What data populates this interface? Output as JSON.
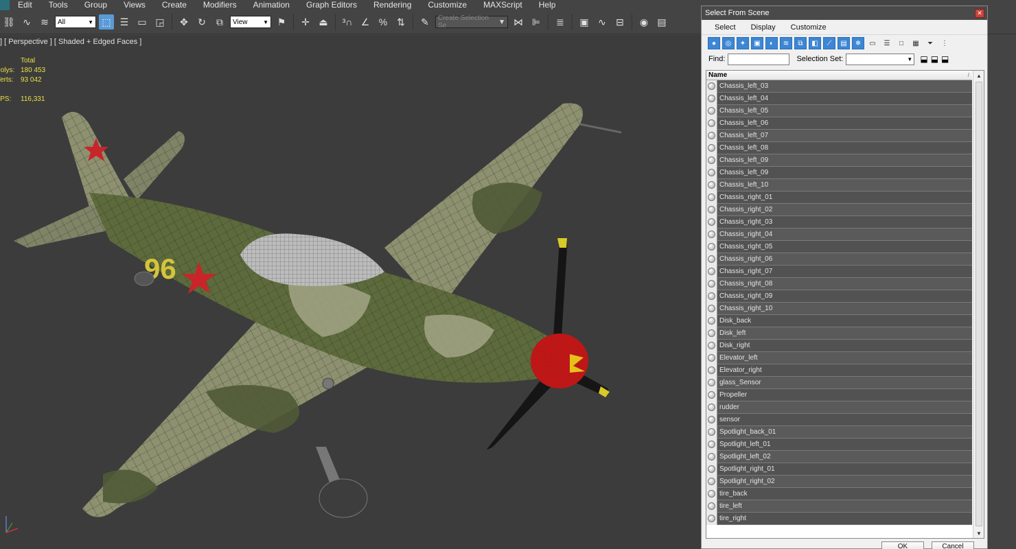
{
  "menu": [
    "Edit",
    "Tools",
    "Group",
    "Views",
    "Create",
    "Modifiers",
    "Animation",
    "Graph Editors",
    "Rendering",
    "Customize",
    "MAXScript",
    "Help"
  ],
  "toolbar": {
    "filter_select": "All",
    "reference_select": "View",
    "selection_set_placeholder": "Create Selection Se"
  },
  "viewport": {
    "label": "] [ Perspective ] [ Shaded + Edged Faces ]",
    "stats": {
      "header": "Total",
      "polys_label": "Polys:",
      "polys": "180 453",
      "verts_label": "Verts:",
      "verts": "93 042",
      "fps_label": "FPS:",
      "fps": "116,331"
    },
    "model_numeral": "96"
  },
  "dialog": {
    "title": "Select From Scene",
    "menu": [
      "Select",
      "Display",
      "Customize"
    ],
    "find_label": "Find:",
    "selection_set_label": "Selection Set:",
    "column_header": "Name",
    "items": [
      "Chassis_left_03",
      "Chassis_left_04",
      "Chassis_left_05",
      "Chassis_left_06",
      "Chassis_left_07",
      "Chassis_left_08",
      "Chassis_left_09",
      "Chassis_left_09",
      "Chassis_left_10",
      "Chassis_right_01",
      "Chassis_right_02",
      "Chassis_right_03",
      "Chassis_right_04",
      "Chassis_right_05",
      "Chassis_right_06",
      "Chassis_right_07",
      "Chassis_right_08",
      "Chassis_right_09",
      "Chassis_right_10",
      "Disk_back",
      "Disk_left",
      "Disk_right",
      "Elevator_left",
      "Elevator_right",
      "glass_Sensor",
      "Propeller",
      "rudder",
      "sensor",
      "Spotlight_back_01",
      "Spotlight_left_01",
      "Spotlight_left_02",
      "Spotlight_right_01",
      "Spotlight_right_02",
      "tire_back",
      "tire_left",
      "tire_right"
    ],
    "ok_label": "OK",
    "cancel_label": "Cancel"
  },
  "colors": {
    "app_bg": "#444444",
    "viewport_bg": "#3c3c3c",
    "stats_text": "#e8e045",
    "active_tool": "#5a9ad6",
    "list_row": "#5a5a5a"
  }
}
